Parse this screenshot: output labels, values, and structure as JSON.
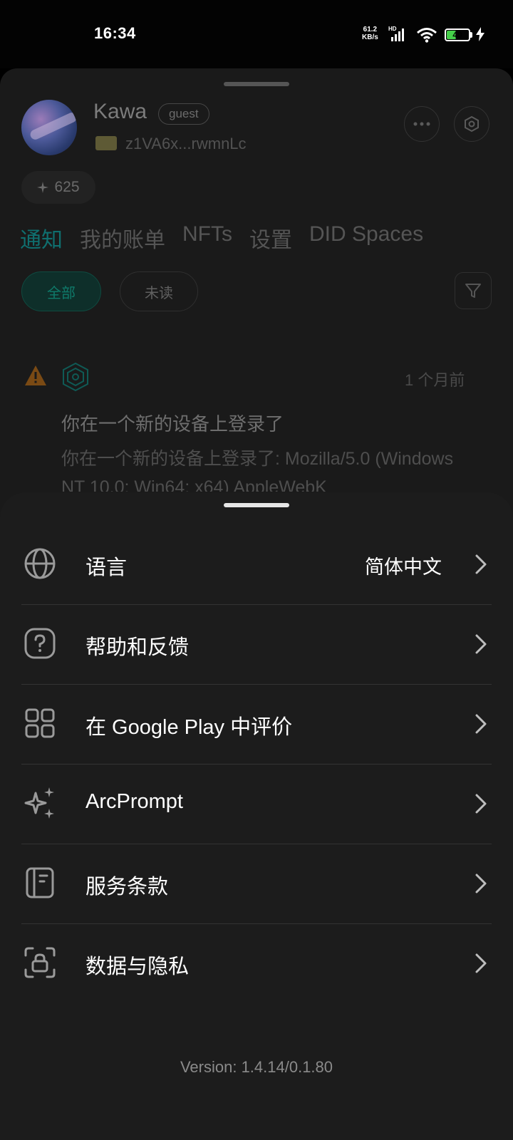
{
  "status_bar": {
    "time": "16:34",
    "net_speed_value": "61.2",
    "net_speed_unit": "KB/s",
    "hd": "HD",
    "battery_level": "40",
    "battery_fraction": 0.4
  },
  "profile": {
    "name": "Kawa",
    "role_badge": "guest",
    "did": "z1VA6x...rwmnLc",
    "credits": "625"
  },
  "tabs": [
    {
      "label": "通知",
      "active": true
    },
    {
      "label": "我的账单",
      "active": false
    },
    {
      "label": "NFTs",
      "active": false
    },
    {
      "label": "设置",
      "active": false
    },
    {
      "label": "DID Spaces",
      "active": false
    }
  ],
  "filters": {
    "all": "全部",
    "unread": "未读"
  },
  "notification": {
    "time": "1 个月前",
    "title": "你在一个新的设备上登录了",
    "body": "你在一个新的设备上登录了: Mozilla/5.0 (Windows NT 10.0; Win64; x64) AppleWebK"
  },
  "settings_menu": {
    "items": [
      {
        "label": "语言",
        "value": "简体中文",
        "icon": "globe-icon"
      },
      {
        "label": "帮助和反馈",
        "value": "",
        "icon": "help-icon"
      },
      {
        "label": "在 Google Play 中评价",
        "value": "",
        "icon": "apps-grid-icon"
      },
      {
        "label": "ArcPrompt",
        "value": "",
        "icon": "sparkle-icon"
      },
      {
        "label": "服务条款",
        "value": "",
        "icon": "book-icon"
      },
      {
        "label": "数据与隐私",
        "value": "",
        "icon": "privacy-lock-icon"
      }
    ],
    "version": "Version: 1.4.14/0.1.80"
  },
  "colors": {
    "accent": "#0f7a6a",
    "sheet_bg": "#1c1c1c",
    "warning": "#d9821a",
    "battery": "#45d04a"
  }
}
